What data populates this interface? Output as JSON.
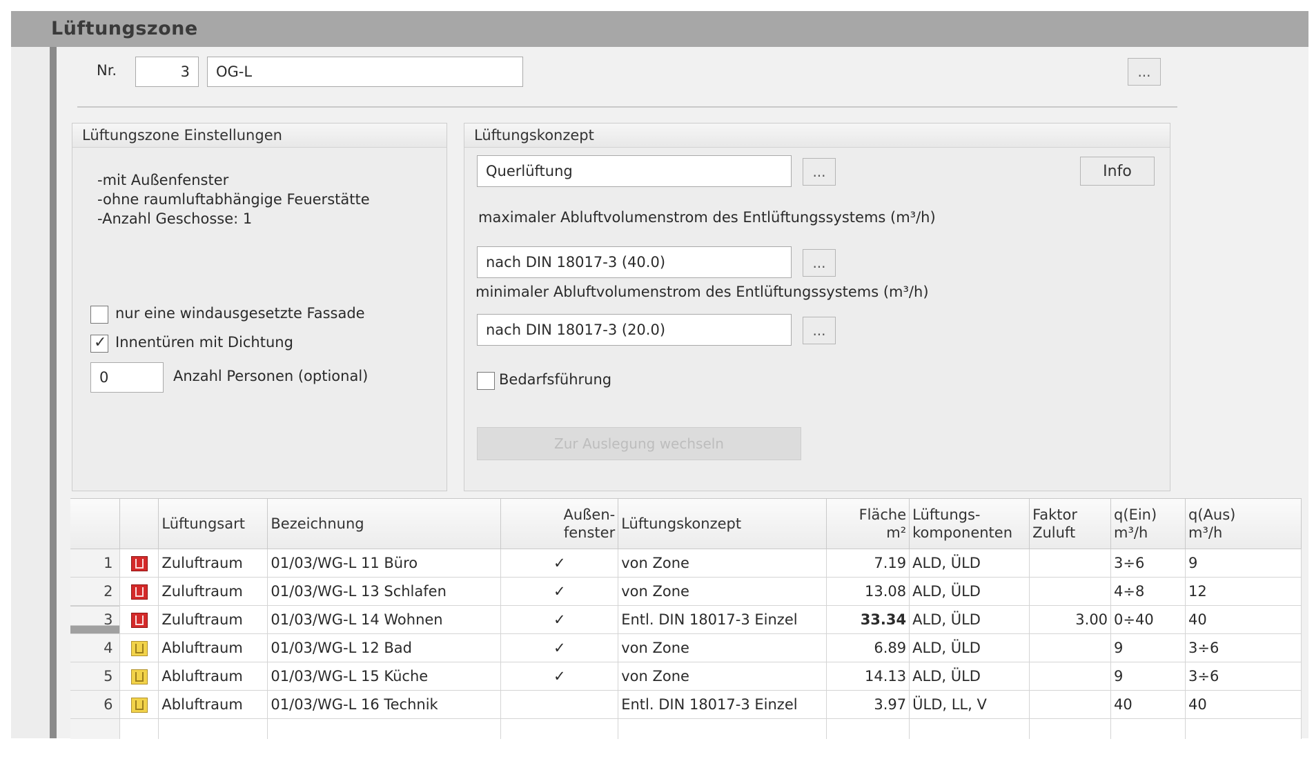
{
  "window": {
    "title": "Lüftungszone"
  },
  "zone": {
    "nr_label": "Nr.",
    "nr_value": "3",
    "name_value": "OG-L",
    "more_button": "..."
  },
  "settings": {
    "title": "Lüftungszone Einstellungen",
    "info_lines": [
      "-mit Außenfenster",
      "-ohne raumluftabhängige Feuerstätte",
      "-Anzahl Geschosse: 1"
    ],
    "windexposed_label": "nur eine windausgesetzte Fassade",
    "windexposed_checked": false,
    "innentueren_label": "Innentüren mit Dichtung",
    "innentueren_checked": true,
    "persons_value": "0",
    "persons_label": "Anzahl Personen (optional)"
  },
  "concept": {
    "title": "Lüftungskonzept",
    "concept_value": "Querlüftung",
    "concept_more": "...",
    "info_button": "Info",
    "max_label": "maximaler Abluftvolumenstrom des Entlüftungssystems (m³/h)",
    "max_value": "nach DIN 18017-3 (40.0)",
    "max_more": "...",
    "min_label": "minimaler Abluftvolumenstrom des Entlüftungssystems (m³/h)",
    "min_value": "nach DIN 18017-3 (20.0)",
    "min_more": "...",
    "demand_label": "Bedarfsführung",
    "demand_checked": false,
    "switch_button": "Zur Auslegung wechseln"
  },
  "table": {
    "headers": {
      "art": "Lüftungsart",
      "bez": "Bezeichnung",
      "aussen_1": "Außen-",
      "aussen_2": "fenster",
      "konzept": "Lüftungskonzept",
      "flaeche_1": "Fläche",
      "flaeche_2": "m²",
      "komp_1": "Lüftungs-",
      "komp_2": "komponenten",
      "faktor_1": "Faktor",
      "faktor_2": "Zuluft",
      "qein_1": "q(Ein)",
      "qein_2": "m³/h",
      "qaus_1": "q(Aus)",
      "qaus_2": "m³/h"
    },
    "rows": [
      {
        "n": "1",
        "icon": "supply-room-icon",
        "art": "Zuluftraum",
        "bez": "01/03/WG-L 11 Büro",
        "aussen": "✓",
        "konzept": "von Zone",
        "flaeche": "7.19",
        "komp": "ALD, ÜLD",
        "faktor": "",
        "qein": "3÷6",
        "qaus": "9"
      },
      {
        "n": "2",
        "icon": "supply-room-icon",
        "art": "Zuluftraum",
        "bez": "01/03/WG-L 13 Schlafen",
        "aussen": "✓",
        "konzept": "von Zone",
        "flaeche": "13.08",
        "komp": "ALD, ÜLD",
        "faktor": "",
        "qein": "4÷8",
        "qaus": "12"
      },
      {
        "n": "3",
        "icon": "supply-room-icon",
        "art": "Zuluftraum",
        "bez": "01/03/WG-L 14 Wohnen",
        "aussen": "✓",
        "konzept": "Entl. DIN 18017-3 Einzel",
        "flaeche": "33.34",
        "komp": "ALD, ÜLD",
        "faktor": "3.00",
        "qein": "0÷40",
        "qaus": "40"
      },
      {
        "n": "4",
        "icon": "exhaust-room-icon",
        "art": "Abluftraum",
        "bez": "01/03/WG-L 12 Bad",
        "aussen": "✓",
        "konzept": "von Zone",
        "flaeche": "6.89",
        "komp": "ALD, ÜLD",
        "faktor": "",
        "qein": "9",
        "qaus": "3÷6"
      },
      {
        "n": "5",
        "icon": "exhaust-room-icon",
        "art": "Abluftraum",
        "bez": "01/03/WG-L 15 Küche",
        "aussen": "✓",
        "konzept": "von Zone",
        "flaeche": "14.13",
        "komp": "ALD, ÜLD",
        "faktor": "",
        "qein": "9",
        "qaus": "3÷6"
      },
      {
        "n": "6",
        "icon": "exhaust-room-icon",
        "art": "Abluftraum",
        "bez": "01/03/WG-L 16 Technik",
        "aussen": "",
        "konzept": "Entl. DIN 18017-3 Einzel",
        "flaeche": "3.97",
        "komp": "ÜLD, LL, V",
        "faktor": "",
        "qein": "40",
        "qaus": "40"
      }
    ],
    "selected_row": 3
  }
}
